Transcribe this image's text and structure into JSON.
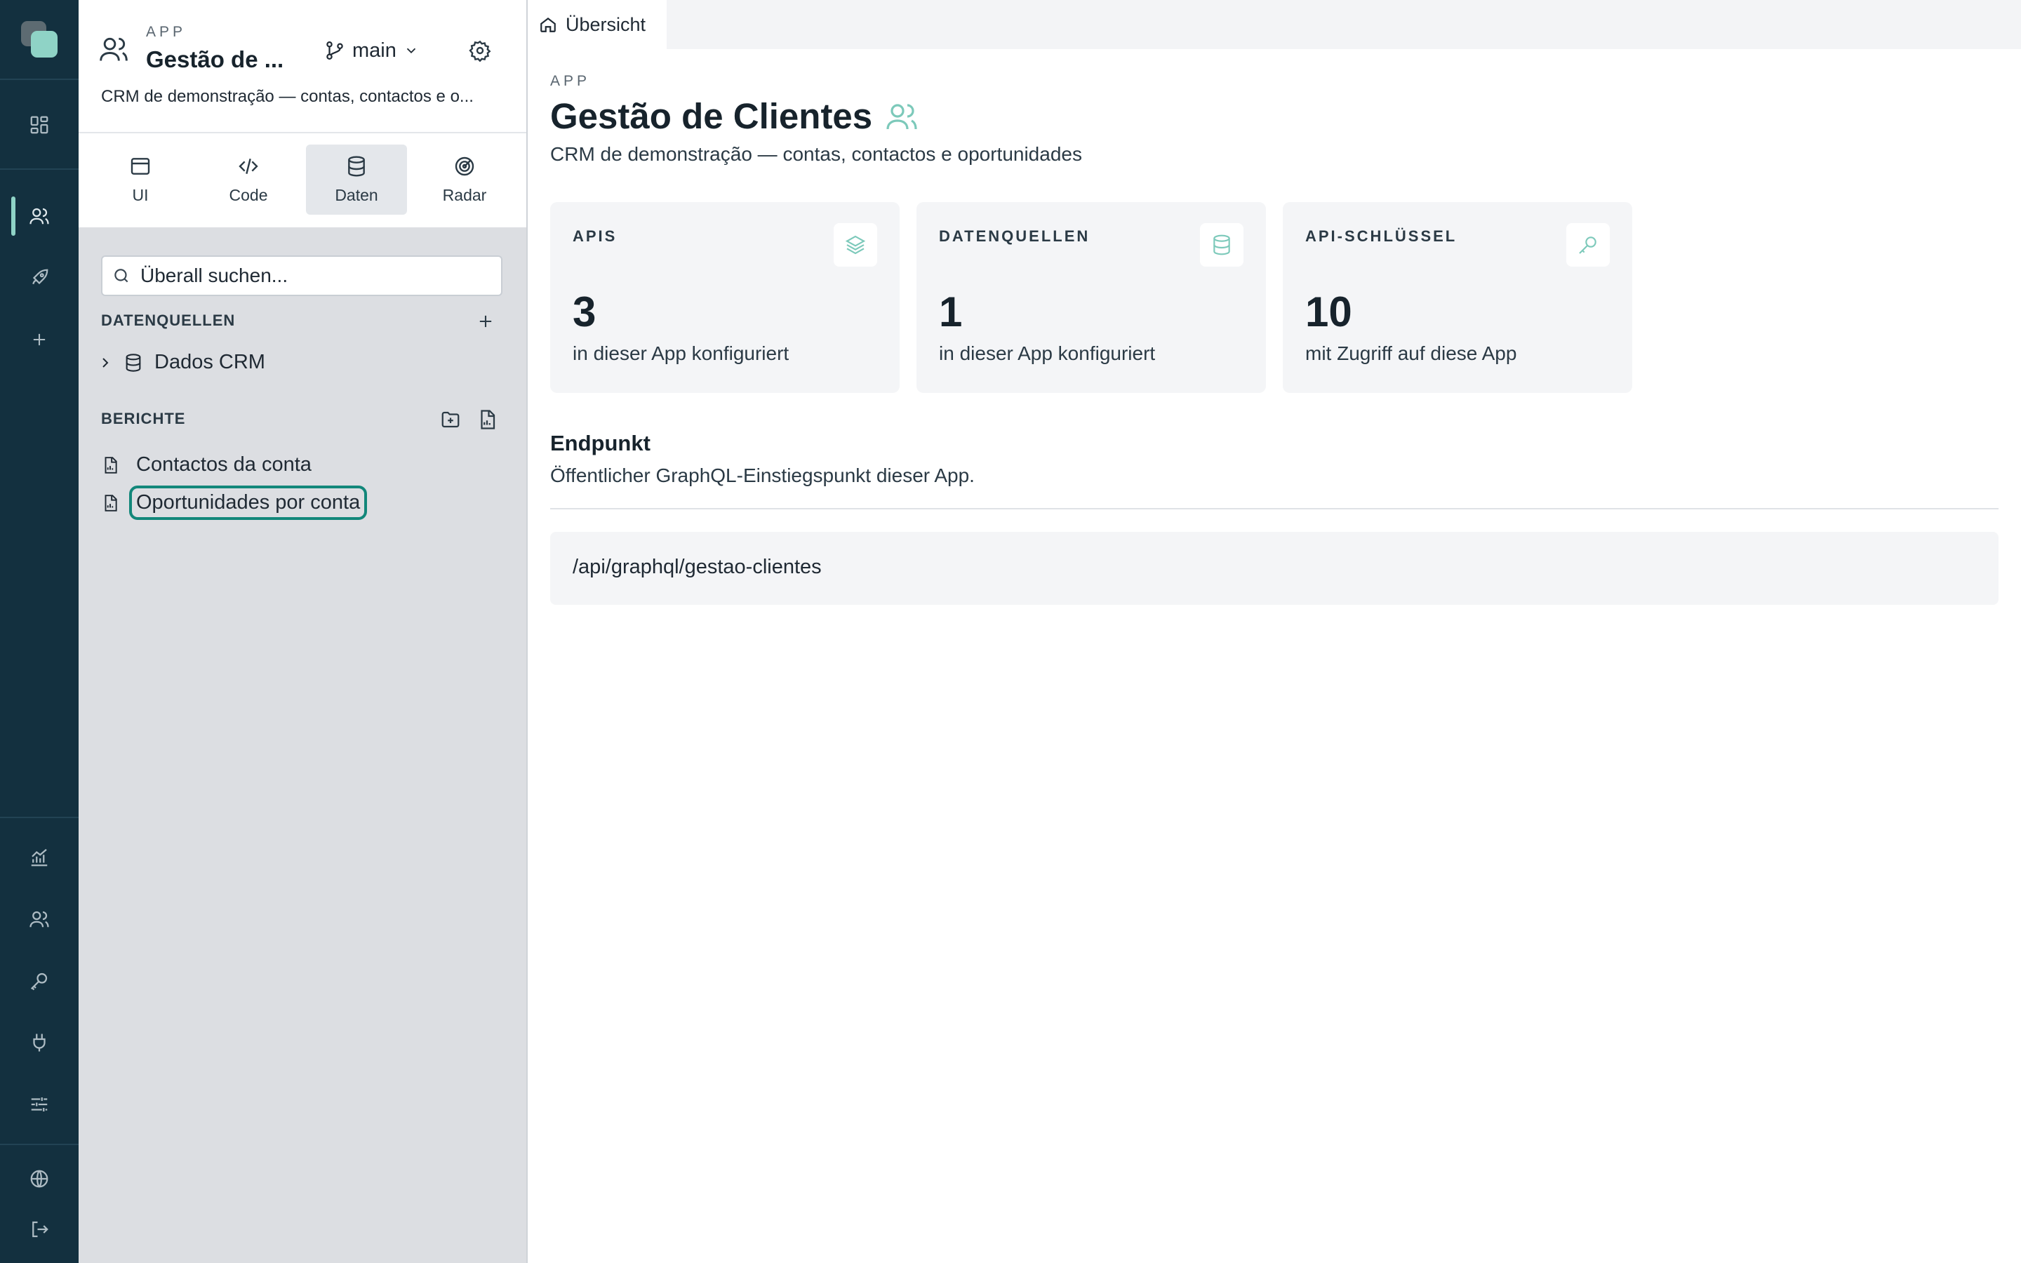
{
  "rail": {
    "items": [
      "dashboard-icon",
      "users-icon",
      "rocket-icon",
      "plus-icon",
      "analytics-icon",
      "team-icon",
      "key-icon",
      "plug-icon",
      "sliders-icon",
      "globe-icon",
      "logout-icon"
    ],
    "accent": "#8fd3c6"
  },
  "sidebar": {
    "eyebrow": "APP",
    "title": "Gestão de ...",
    "branch": "main",
    "description": "CRM de demonstração — contas, contactos e o...",
    "tabs": [
      {
        "label": "UI",
        "icon": "browser-window-icon"
      },
      {
        "label": "Code",
        "icon": "code-icon"
      },
      {
        "label": "Daten",
        "icon": "database-icon"
      },
      {
        "label": "Radar",
        "icon": "radar-icon"
      }
    ],
    "active_tab": "Daten",
    "search": {
      "placeholder": "Überall suchen..."
    },
    "datasources": {
      "title": "DATENQUELLEN",
      "items": [
        {
          "label": "Dados CRM"
        }
      ]
    },
    "reports": {
      "title": "BERICHTE",
      "items": [
        {
          "label": "Contactos da conta"
        },
        {
          "label": "Oportunidades por conta"
        }
      ],
      "selected": "Oportunidades por conta"
    }
  },
  "tabbar": {
    "tabs": [
      {
        "label": "Übersicht",
        "icon": "home-icon"
      }
    ]
  },
  "main": {
    "eyebrow": "APP",
    "title": "Gestão de Clientes",
    "subtitle": "CRM de demonstração — contas, contactos e oportunidades",
    "cards": [
      {
        "title": "APIS",
        "value": "3",
        "caption": "in dieser App konfiguriert",
        "icon": "layers-icon"
      },
      {
        "title": "DATENQUELLEN",
        "value": "1",
        "caption": "in dieser App konfiguriert",
        "icon": "database-icon"
      },
      {
        "title": "API-SCHLÜSSEL",
        "value": "10",
        "caption": "mit Zugriff auf diese App",
        "icon": "key-icon"
      }
    ],
    "endpoint": {
      "title": "Endpunkt",
      "subtitle": "Öffentlicher GraphQL-Einstiegspunkt dieser App.",
      "value": "/api/graphql/gestao-clientes"
    }
  },
  "colors": {
    "rail_bg": "#13303f",
    "accent": "#8fd3c6",
    "selection": "#12877a",
    "panel_bg": "#dcdee2"
  }
}
